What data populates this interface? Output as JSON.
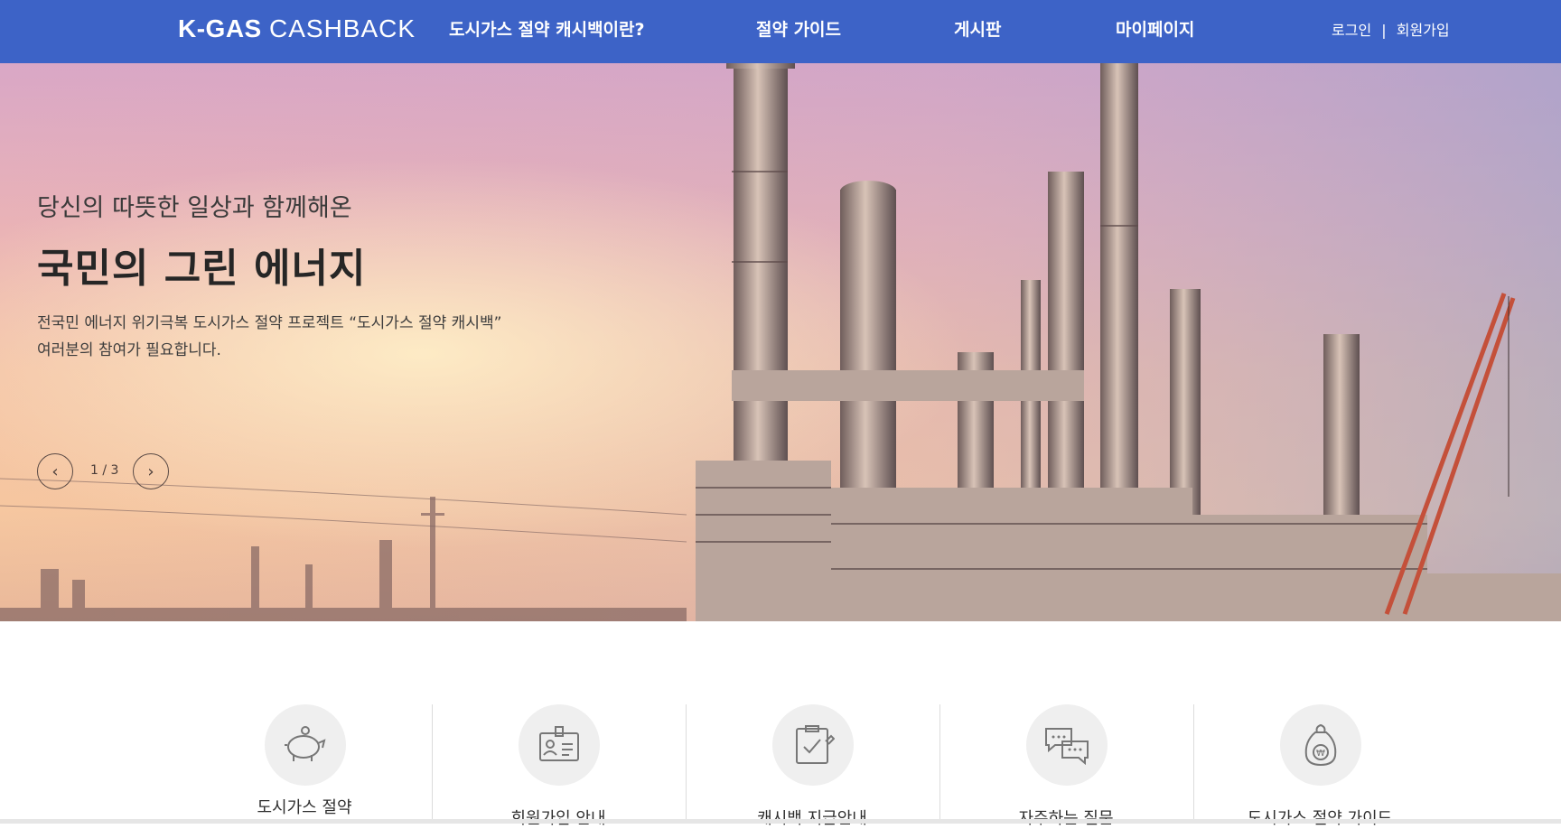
{
  "header": {
    "logo_bold": "K-GAS",
    "logo_light": "CASHBACK",
    "nav": [
      "도시가스 절약 캐시백이란?",
      "절약 가이드",
      "게시판",
      "마이페이지"
    ],
    "login": "로그인",
    "separator": "|",
    "signup": "회원가입",
    "bg_color": "#3d63c7"
  },
  "hero": {
    "subtitle": "당신의 따뜻한 일상과 함께해온",
    "title": "국민의 그린 에너지",
    "desc_line1": "전국민 에너지 위기극복 도시가스 절약 프로젝트 “도시가스 절약 캐시백”",
    "desc_line2": "여러분의 참여가 필요합니다.",
    "prev_icon": "chevron-left-icon",
    "next_icon": "chevron-right-icon",
    "pager": "1 / 3",
    "image": "refinery-sunset"
  },
  "quick_menu": [
    {
      "label": "도시가스 절약",
      "icon": "piggy-bank-icon"
    },
    {
      "label": "회원가입 안내",
      "icon": "id-card-icon"
    },
    {
      "label": "캐시백 지급안내",
      "icon": "clipboard-check-icon"
    },
    {
      "label": "자주하는 질문",
      "icon": "chat-bubbles-icon"
    },
    {
      "label": "도시가스 절약 가이드",
      "icon": "money-bag-icon"
    }
  ]
}
